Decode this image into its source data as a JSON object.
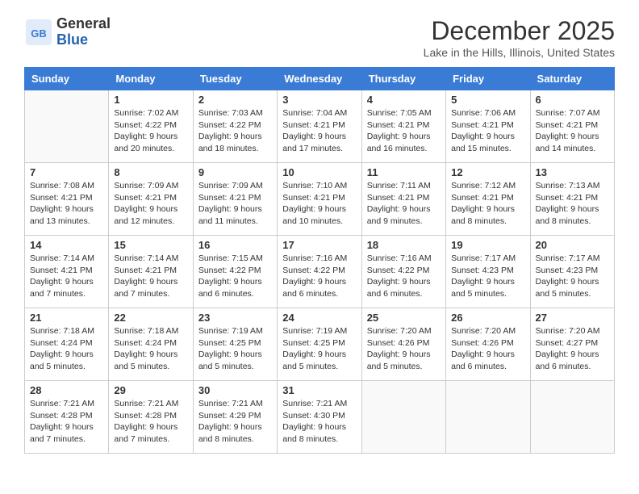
{
  "header": {
    "logo_line1": "General",
    "logo_line2": "Blue",
    "month": "December 2025",
    "location": "Lake in the Hills, Illinois, United States"
  },
  "days_of_week": [
    "Sunday",
    "Monday",
    "Tuesday",
    "Wednesday",
    "Thursday",
    "Friday",
    "Saturday"
  ],
  "weeks": [
    [
      {
        "day": "",
        "info": ""
      },
      {
        "day": "1",
        "info": "Sunrise: 7:02 AM\nSunset: 4:22 PM\nDaylight: 9 hours\nand 20 minutes."
      },
      {
        "day": "2",
        "info": "Sunrise: 7:03 AM\nSunset: 4:22 PM\nDaylight: 9 hours\nand 18 minutes."
      },
      {
        "day": "3",
        "info": "Sunrise: 7:04 AM\nSunset: 4:21 PM\nDaylight: 9 hours\nand 17 minutes."
      },
      {
        "day": "4",
        "info": "Sunrise: 7:05 AM\nSunset: 4:21 PM\nDaylight: 9 hours\nand 16 minutes."
      },
      {
        "day": "5",
        "info": "Sunrise: 7:06 AM\nSunset: 4:21 PM\nDaylight: 9 hours\nand 15 minutes."
      },
      {
        "day": "6",
        "info": "Sunrise: 7:07 AM\nSunset: 4:21 PM\nDaylight: 9 hours\nand 14 minutes."
      }
    ],
    [
      {
        "day": "7",
        "info": "Sunrise: 7:08 AM\nSunset: 4:21 PM\nDaylight: 9 hours\nand 13 minutes."
      },
      {
        "day": "8",
        "info": "Sunrise: 7:09 AM\nSunset: 4:21 PM\nDaylight: 9 hours\nand 12 minutes."
      },
      {
        "day": "9",
        "info": "Sunrise: 7:09 AM\nSunset: 4:21 PM\nDaylight: 9 hours\nand 11 minutes."
      },
      {
        "day": "10",
        "info": "Sunrise: 7:10 AM\nSunset: 4:21 PM\nDaylight: 9 hours\nand 10 minutes."
      },
      {
        "day": "11",
        "info": "Sunrise: 7:11 AM\nSunset: 4:21 PM\nDaylight: 9 hours\nand 9 minutes."
      },
      {
        "day": "12",
        "info": "Sunrise: 7:12 AM\nSunset: 4:21 PM\nDaylight: 9 hours\nand 8 minutes."
      },
      {
        "day": "13",
        "info": "Sunrise: 7:13 AM\nSunset: 4:21 PM\nDaylight: 9 hours\nand 8 minutes."
      }
    ],
    [
      {
        "day": "14",
        "info": "Sunrise: 7:14 AM\nSunset: 4:21 PM\nDaylight: 9 hours\nand 7 minutes."
      },
      {
        "day": "15",
        "info": "Sunrise: 7:14 AM\nSunset: 4:21 PM\nDaylight: 9 hours\nand 7 minutes."
      },
      {
        "day": "16",
        "info": "Sunrise: 7:15 AM\nSunset: 4:22 PM\nDaylight: 9 hours\nand 6 minutes."
      },
      {
        "day": "17",
        "info": "Sunrise: 7:16 AM\nSunset: 4:22 PM\nDaylight: 9 hours\nand 6 minutes."
      },
      {
        "day": "18",
        "info": "Sunrise: 7:16 AM\nSunset: 4:22 PM\nDaylight: 9 hours\nand 6 minutes."
      },
      {
        "day": "19",
        "info": "Sunrise: 7:17 AM\nSunset: 4:23 PM\nDaylight: 9 hours\nand 5 minutes."
      },
      {
        "day": "20",
        "info": "Sunrise: 7:17 AM\nSunset: 4:23 PM\nDaylight: 9 hours\nand 5 minutes."
      }
    ],
    [
      {
        "day": "21",
        "info": "Sunrise: 7:18 AM\nSunset: 4:24 PM\nDaylight: 9 hours\nand 5 minutes."
      },
      {
        "day": "22",
        "info": "Sunrise: 7:18 AM\nSunset: 4:24 PM\nDaylight: 9 hours\nand 5 minutes."
      },
      {
        "day": "23",
        "info": "Sunrise: 7:19 AM\nSunset: 4:25 PM\nDaylight: 9 hours\nand 5 minutes."
      },
      {
        "day": "24",
        "info": "Sunrise: 7:19 AM\nSunset: 4:25 PM\nDaylight: 9 hours\nand 5 minutes."
      },
      {
        "day": "25",
        "info": "Sunrise: 7:20 AM\nSunset: 4:26 PM\nDaylight: 9 hours\nand 5 minutes."
      },
      {
        "day": "26",
        "info": "Sunrise: 7:20 AM\nSunset: 4:26 PM\nDaylight: 9 hours\nand 6 minutes."
      },
      {
        "day": "27",
        "info": "Sunrise: 7:20 AM\nSunset: 4:27 PM\nDaylight: 9 hours\nand 6 minutes."
      }
    ],
    [
      {
        "day": "28",
        "info": "Sunrise: 7:21 AM\nSunset: 4:28 PM\nDaylight: 9 hours\nand 7 minutes."
      },
      {
        "day": "29",
        "info": "Sunrise: 7:21 AM\nSunset: 4:28 PM\nDaylight: 9 hours\nand 7 minutes."
      },
      {
        "day": "30",
        "info": "Sunrise: 7:21 AM\nSunset: 4:29 PM\nDaylight: 9 hours\nand 8 minutes."
      },
      {
        "day": "31",
        "info": "Sunrise: 7:21 AM\nSunset: 4:30 PM\nDaylight: 9 hours\nand 8 minutes."
      },
      {
        "day": "",
        "info": ""
      },
      {
        "day": "",
        "info": ""
      },
      {
        "day": "",
        "info": ""
      }
    ]
  ]
}
